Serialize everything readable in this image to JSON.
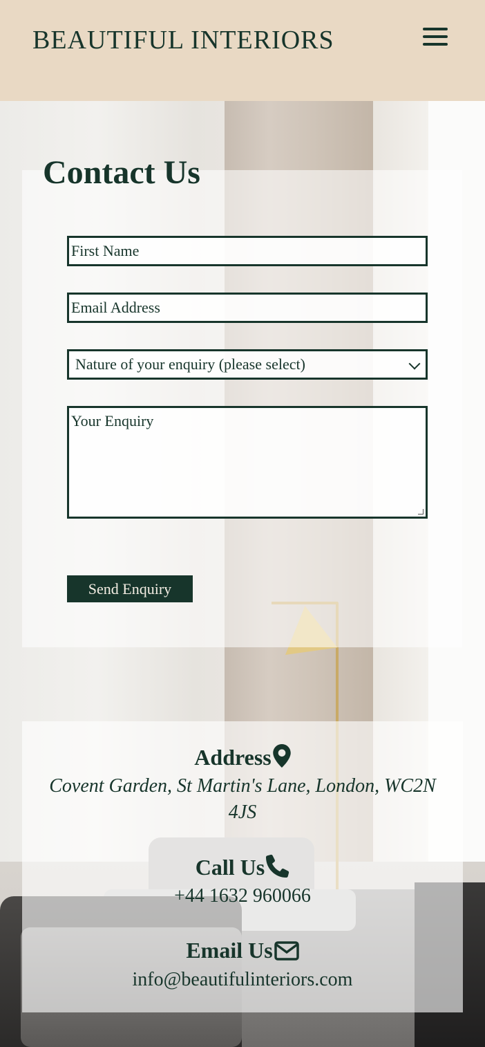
{
  "header": {
    "brand": "BEAUTIFUL INTERIORS",
    "menu_icon": "hamburger-menu-icon",
    "background": "#e9d9c4"
  },
  "contact": {
    "title": "Contact Us",
    "first_name_placeholder": "First Name",
    "email_placeholder": "Email Address",
    "enquiry_select_value": "Nature of your enquiry (please select)",
    "enquiry_textarea_placeholder": "Your Enquiry",
    "send_label": "Send Enquiry"
  },
  "info": {
    "address_heading": "Address",
    "address_icon": "map-pin-icon",
    "address_text": "Covent Garden, St Martin's Lane, London, WC2N 4JS",
    "call_heading": "Call Us",
    "call_icon": "phone-icon",
    "phone": "+44 1632 960066",
    "email_heading": "Email Us",
    "email_icon": "envelope-icon",
    "email": "info@beautifulinteriors.com"
  },
  "colors": {
    "primary": "#17352b",
    "header_bg": "#e9d9c4",
    "button_text": "#f3ede3"
  }
}
